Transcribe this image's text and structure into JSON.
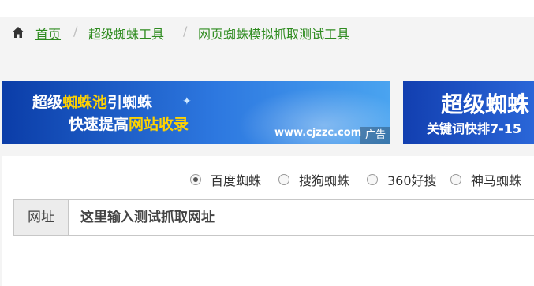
{
  "breadcrumb": {
    "home_label": "首页",
    "separator": "/",
    "middle_label": "超级蜘蛛工具",
    "current_label": "网页蜘蛛模拟抓取测试工具"
  },
  "ad_banner_1": {
    "line1_a": "超级",
    "line1_b": "蜘蛛池",
    "line1_c": "引蜘蛛",
    "line2_a": "快速提高",
    "line2_b": "网站收录",
    "url": "www.cjzzc.com",
    "ad_label": "广告"
  },
  "ad_banner_2": {
    "line1": "超级蜘蛛",
    "line2": "关键词快排7-15"
  },
  "spider_options": [
    {
      "label": "百度蜘蛛",
      "selected": true
    },
    {
      "label": "搜狗蜘蛛",
      "selected": false
    },
    {
      "label": "360好搜",
      "selected": false
    },
    {
      "label": "神马蜘蛛",
      "selected": false
    }
  ],
  "url_field": {
    "label": "网址",
    "placeholder": "这里输入测试抓取网址",
    "value": ""
  },
  "colors": {
    "link_green": "#2e8b1f",
    "banner_blue": "#1f5fd0",
    "highlight_yellow": "#ffd200"
  }
}
